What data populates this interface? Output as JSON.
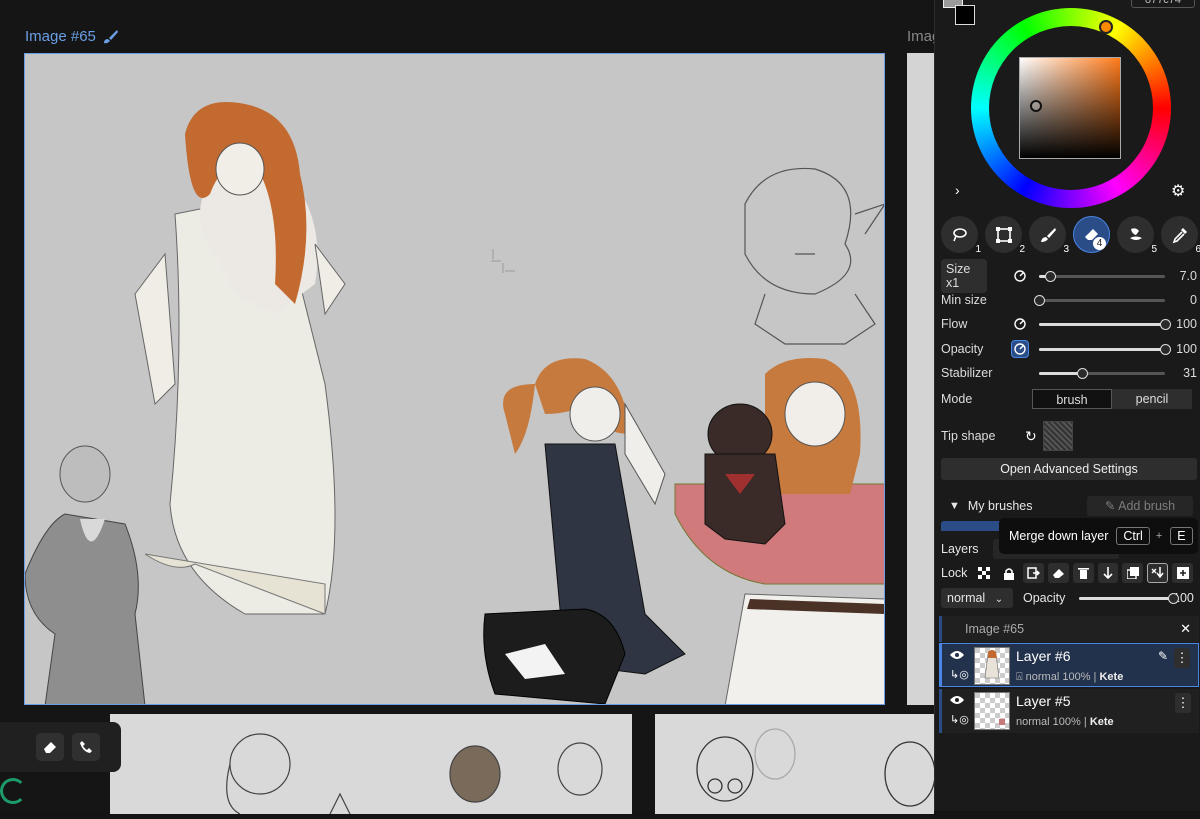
{
  "canvas": {
    "title": "Image #65",
    "second_title": "Imag"
  },
  "color": {
    "hex": "877c74",
    "foreground": "#9a9a9a",
    "background": "#000000"
  },
  "tools": [
    {
      "icon": "lasso-icon",
      "num": "1"
    },
    {
      "icon": "transform-icon",
      "num": "2"
    },
    {
      "icon": "brush-icon",
      "num": "3"
    },
    {
      "icon": "eraser-icon",
      "num": "4",
      "active": true
    },
    {
      "icon": "smudge-icon",
      "num": "5"
    },
    {
      "icon": "eyedropper-icon",
      "num": "6"
    }
  ],
  "brush": {
    "size_label": "Size x1",
    "size_value": "7.0",
    "size_fraction": 0.09,
    "min_size_label": "Min size",
    "min_size_value": "0",
    "min_size_fraction": 0.0,
    "flow_label": "Flow",
    "flow_value": "100",
    "flow_fraction": 1.0,
    "opacity_label": "Opacity",
    "opacity_value": "100",
    "opacity_fraction": 1.0,
    "stabilizer_label": "Stabilizer",
    "stabilizer_value": "31",
    "stabilizer_fraction": 0.34,
    "mode_label": "Mode",
    "mode_options": [
      "brush",
      "pencil"
    ],
    "mode_selected": "brush",
    "tip_shape_label": "Tip shape",
    "advanced_label": "Open Advanced Settings"
  },
  "my_brushes": {
    "label": "My brushes",
    "add_label": "Add brush"
  },
  "tooltip": {
    "text": "Merge down layer",
    "key1": "Ctrl",
    "plus": "+",
    "key2": "E"
  },
  "layers": {
    "label": "Layers",
    "lock_label": "Lock",
    "blend_mode": "normal",
    "opacity_label": "Opacity",
    "opacity_value": "100",
    "opacity_fraction": 1.0,
    "group_name": "Image #65",
    "items": [
      {
        "name": "Layer #6",
        "mode": "normal 100%",
        "sep": "|",
        "owner": "Kete",
        "selected": true
      },
      {
        "name": "Layer #5",
        "mode": "normal 100%",
        "sep": "|",
        "owner": "Kete",
        "selected": false
      }
    ]
  }
}
